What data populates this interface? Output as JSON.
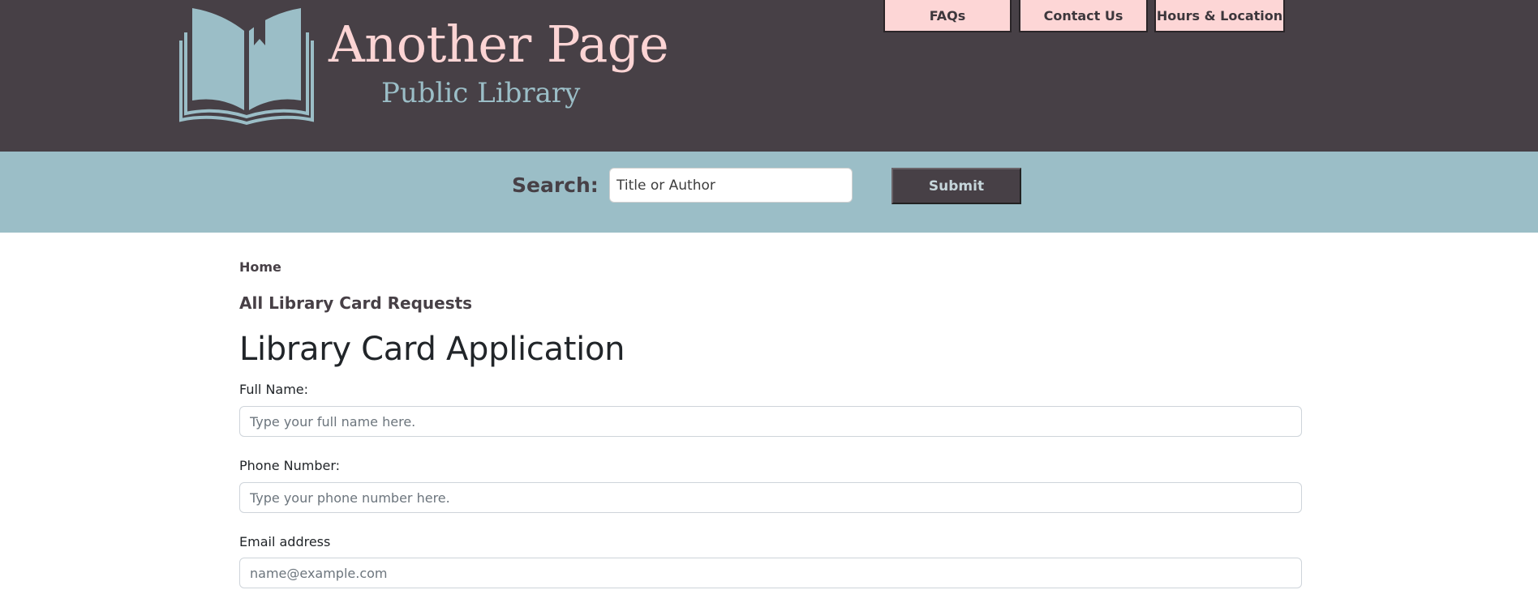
{
  "brand": {
    "title": "Another Page",
    "subtitle": "Public Library",
    "logo_icon": "open-book-icon",
    "colors": {
      "header_bg": "#474046",
      "title": "#fcd4d4",
      "subtitle": "#9bbec7"
    }
  },
  "nav": {
    "faqs": "FAQs",
    "contact": "Contact Us",
    "hours": "Hours & Location",
    "button_bg": "#fdd6d6"
  },
  "search": {
    "label": "Search:",
    "placeholder": "Title or Author",
    "submit_label": "Submit",
    "bar_color": "#9bbec7"
  },
  "breadcrumb": {
    "home": "Home"
  },
  "requests_link": "All Library Card Requests",
  "page_title": "Library Card Application",
  "form": {
    "full_name": {
      "label": "Full Name:",
      "placeholder": "Type your full name here."
    },
    "phone": {
      "label": "Phone Number:",
      "placeholder": "Type your phone number here."
    },
    "email": {
      "label": "Email address",
      "placeholder": "name@example.com"
    }
  }
}
